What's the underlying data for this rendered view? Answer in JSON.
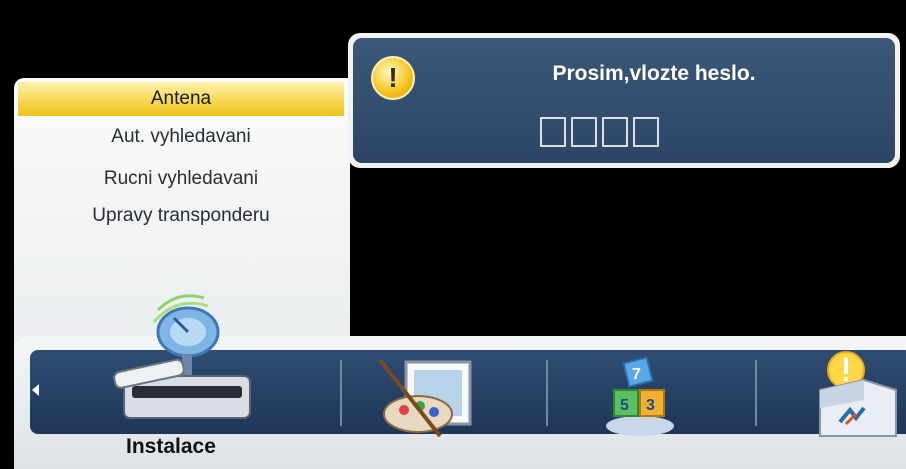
{
  "menu": {
    "items": [
      {
        "label": "Antena",
        "selected": true
      },
      {
        "label": "Aut. vyhledavani",
        "selected": false
      },
      {
        "label": "Rucni vyhledavani",
        "selected": false
      },
      {
        "label": "Upravy transponderu",
        "selected": false
      }
    ]
  },
  "dialog": {
    "icon": "warning-icon",
    "icon_glyph": "!",
    "title": "Prosim,vlozte heslo.",
    "pin_length": 4
  },
  "bottom_bar": {
    "selected_label": "Instalace",
    "icons": [
      "installation-icon",
      "palette-icon",
      "blocks-icon",
      "box-icon"
    ],
    "blocks_icon_digits": [
      "7",
      "5",
      "3"
    ]
  },
  "colors": {
    "accent": "#f0c21e",
    "dialog_bg": "#2c4566",
    "bar_bg": "#1e3658"
  }
}
